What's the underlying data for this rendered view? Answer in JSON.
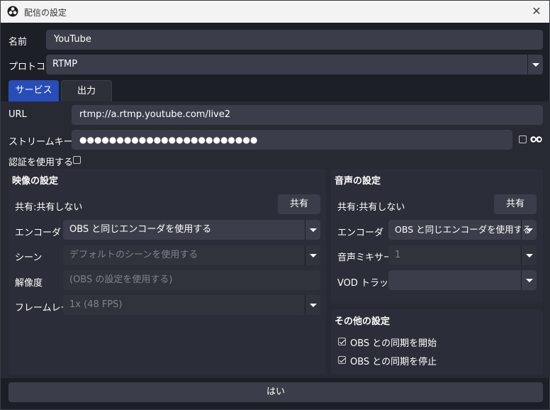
{
  "window": {
    "title": "配信の設定",
    "close_icon": "close-icon",
    "app_icon": "obs-logo-icon"
  },
  "form": {
    "name_label": "名前",
    "name_value": "YouTube",
    "protocol_label": "プロトコル",
    "protocol_value": "RTMP"
  },
  "tabs": [
    {
      "label": "サービス",
      "active": true
    },
    {
      "label": "出力",
      "active": false
    }
  ],
  "service": {
    "url_label": "URL",
    "url_value": "rtmp://a.rtmp.youtube.com/live2",
    "key_label": "ストリームキー",
    "key_value": "●●●●●●●●●●●●●●●●●●●●●●●●",
    "show_key_icon": "eye-icon",
    "auth_label": "認証を使用する"
  },
  "video": {
    "title": "映像の設定",
    "share_label": "共有:共有しない",
    "share_button": "共有",
    "encoder_label": "エンコーダ",
    "encoder_value": "OBS と同じエンコーダを使用する",
    "scene_label": "シーン",
    "scene_value": "デフォルトのシーンを使用する",
    "resolution_label": "解像度",
    "resolution_placeholder": "(OBS の設定を使用する)",
    "framerate_label": "フレームレート",
    "framerate_value": "1x (48 FPS)"
  },
  "audio": {
    "title": "音声の設定",
    "share_label": "共有:共有しない",
    "share_button": "共有",
    "encoder_label": "エンコーダ",
    "encoder_value": "OBS と同じエンコーダを使用する",
    "mixer_label": "音声ミキサー",
    "mixer_value": "1",
    "vod_label": "VOD トラック",
    "vod_value": ""
  },
  "other": {
    "title": "その他の設定",
    "sync_start_label": "OBS との同期を開始",
    "sync_start_checked": true,
    "sync_stop_label": "OBS との同期を停止",
    "sync_stop_checked": true
  },
  "footer": {
    "ok_label": "はい"
  },
  "colors": {
    "accent": "#284cb8",
    "background": "#1d1f26",
    "field": "#3b3e4a"
  }
}
